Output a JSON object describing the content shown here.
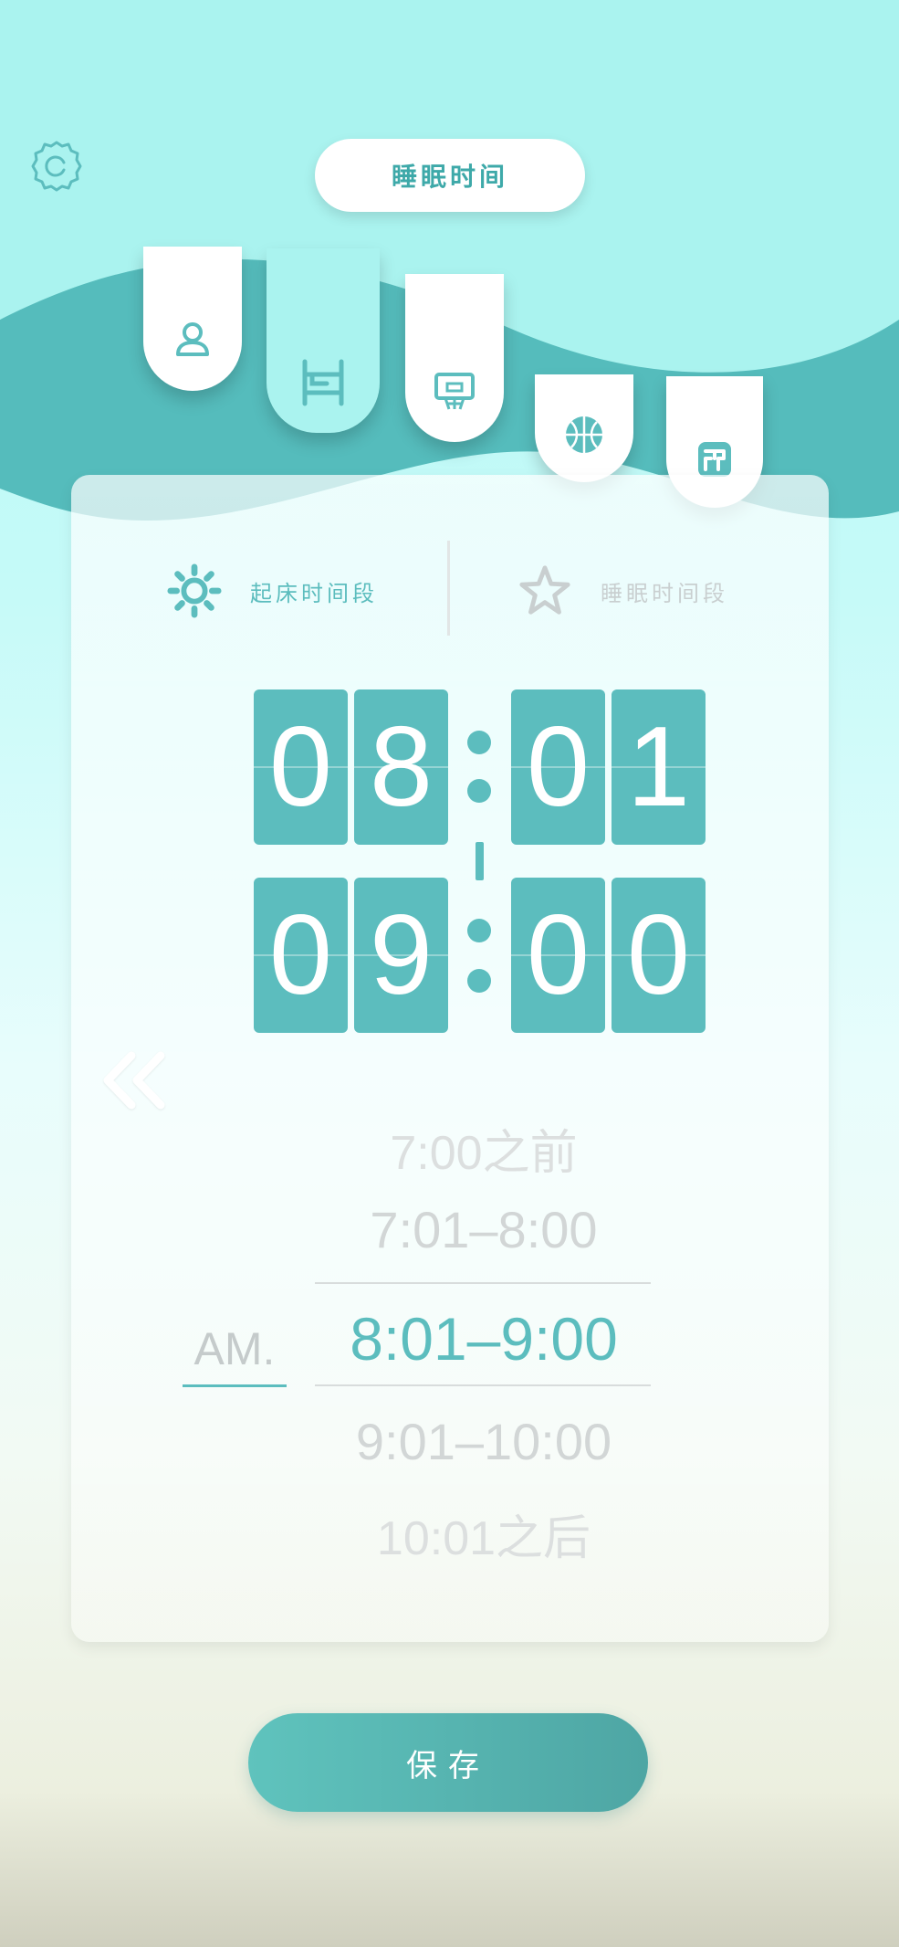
{
  "header": {
    "title": "睡眠时间"
  },
  "tabs": [
    {
      "icon": "person-icon",
      "active": false
    },
    {
      "icon": "bed-icon",
      "active": true
    },
    {
      "icon": "basketball-hoop-icon",
      "active": false
    },
    {
      "icon": "basketball-icon",
      "active": false
    },
    {
      "icon": "tooth-icon",
      "active": false
    }
  ],
  "segments": {
    "wake": {
      "label": "起床时间段",
      "icon": "sun-icon",
      "active": true
    },
    "sleep": {
      "label": "睡眠时间段",
      "icon": "star-icon",
      "active": false
    }
  },
  "clock": {
    "start": {
      "h1": "0",
      "h2": "8",
      "m1": "0",
      "m2": "1"
    },
    "end": {
      "h1": "0",
      "h2": "9",
      "m1": "0",
      "m2": "0"
    }
  },
  "picker": {
    "period": "AM.",
    "options": [
      "7:00之前",
      "7:01–8:00",
      "8:01–9:00",
      "9:01–10:00",
      "10:01之后"
    ],
    "selected_index": 2
  },
  "save_label": "保存",
  "colors": {
    "accent": "#5cbdbe",
    "accent_dark": "#4ea6a4",
    "inactive": "#c9cfd0",
    "wave_light": "#a9f3ef",
    "wave_dark": "#55bcbc"
  }
}
